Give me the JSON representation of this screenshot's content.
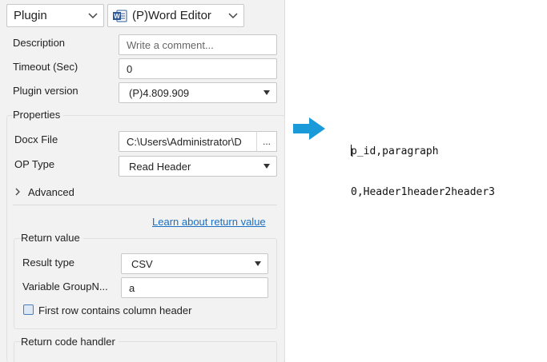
{
  "header": {
    "plugin_select": "Plugin",
    "editor_select": "(P)Word Editor"
  },
  "fields": {
    "description_label": "Description",
    "description_placeholder": "Write a comment...",
    "timeout_label": "Timeout (Sec)",
    "timeout_value": "0",
    "plugin_version_label": "Plugin version",
    "plugin_version_value": "(P)4.809.909"
  },
  "properties": {
    "title": "Properties",
    "docx_label": "Docx File",
    "docx_value": "C:\\Users\\Administrator\\D",
    "browse_label": "...",
    "op_type_label": "OP Type",
    "op_type_value": "Read Header",
    "advanced_label": "Advanced",
    "learn_link": "Learn about return value"
  },
  "return_value": {
    "title": "Return value",
    "result_type_label": "Result type",
    "result_type_value": "CSV",
    "variable_label": "Variable GroupN...",
    "variable_value": "a",
    "checkbox_label": "First row contains column header"
  },
  "return_code": {
    "title": "Return code handler"
  },
  "output": {
    "line1": "p_id,paragraph",
    "line2": "0,Header1header2header3"
  },
  "colors": {
    "arrow": "#1a9ad9",
    "link": "#1a6fc2",
    "word_icon": "#2b579a"
  }
}
